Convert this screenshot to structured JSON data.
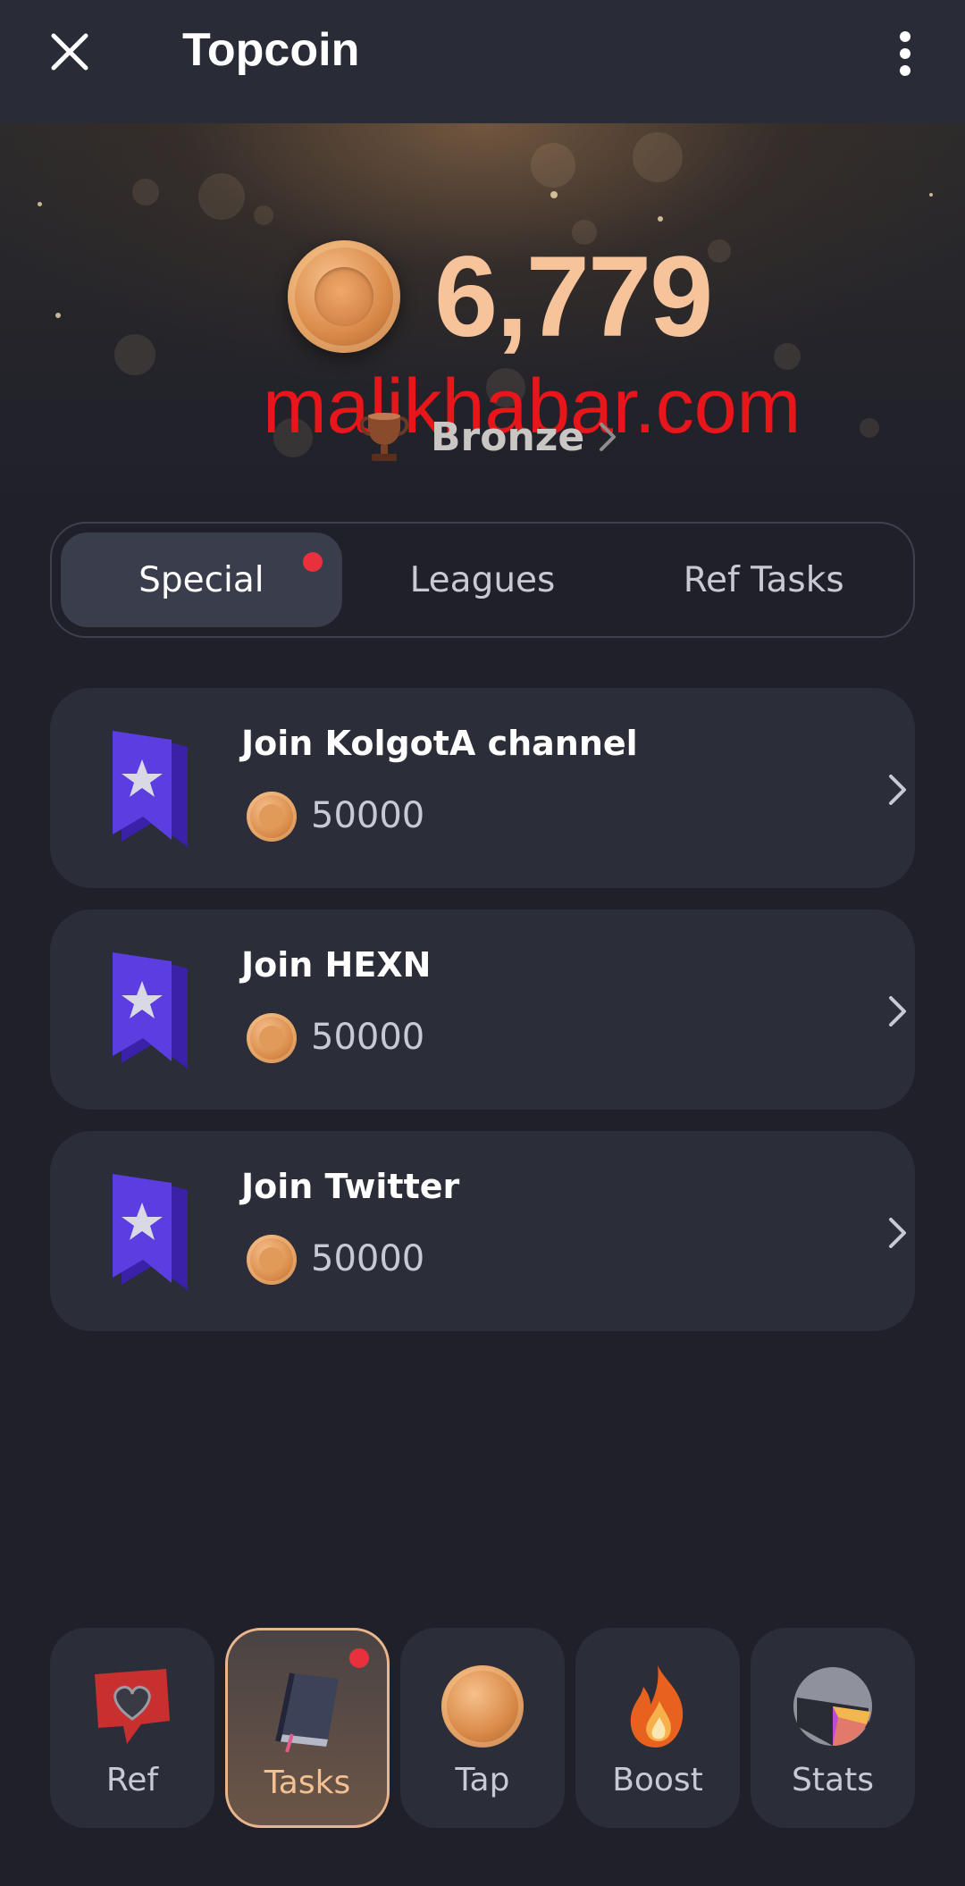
{
  "header": {
    "title": "Topcoin",
    "close_icon": "close-icon",
    "menu_icon": "more-vertical-icon"
  },
  "hero": {
    "balance": "6,779",
    "watermark": "malikhabar.com",
    "league": "Bronze",
    "league_icon": "trophy-icon",
    "balance_color": "#f6c39b"
  },
  "tabs": [
    {
      "label": "Special",
      "active": true,
      "badge": true
    },
    {
      "label": "Leagues",
      "active": false,
      "badge": false
    },
    {
      "label": "Ref Tasks",
      "active": false,
      "badge": false
    }
  ],
  "tasks": [
    {
      "title": "Join KolgotA channel",
      "reward": "50000",
      "icon": "bookmark-star-icon"
    },
    {
      "title": "Join HEXN",
      "reward": "50000",
      "icon": "bookmark-star-icon"
    },
    {
      "title": "Join Twitter",
      "reward": "50000",
      "icon": "bookmark-star-icon"
    }
  ],
  "nav": [
    {
      "label": "Ref",
      "icon": "heart-speech-icon",
      "active": false
    },
    {
      "label": "Tasks",
      "icon": "book-icon",
      "active": true,
      "badge": true
    },
    {
      "label": "Tap",
      "icon": "coin-icon",
      "active": false
    },
    {
      "label": "Boost",
      "icon": "flame-icon",
      "active": false
    },
    {
      "label": "Stats",
      "icon": "stats-icon",
      "active": false
    }
  ],
  "colors": {
    "background": "#1f2029",
    "card": "#2b2d39",
    "accent": "#f3c092",
    "badge": "#e8313d",
    "bookmark": "#5b3de0"
  }
}
